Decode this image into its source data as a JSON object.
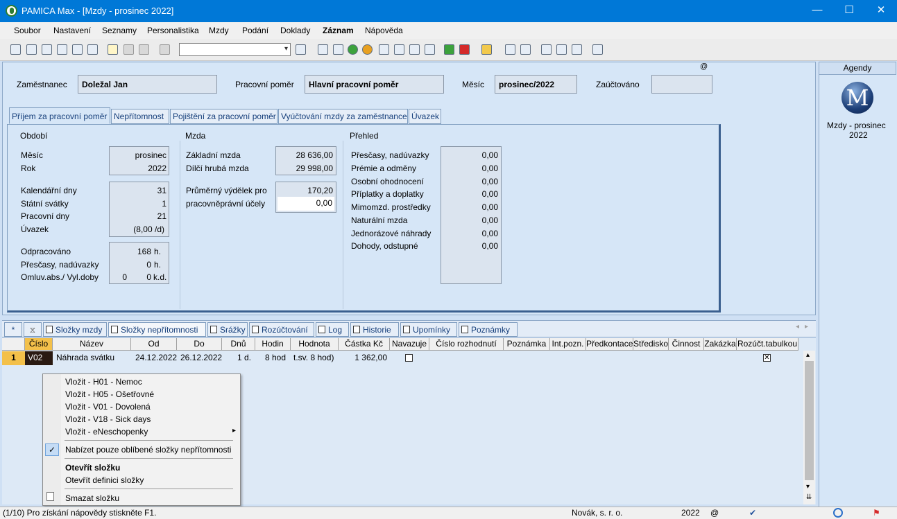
{
  "window": {
    "title": "PAMICA Max - [Mzdy - prosinec 2022]",
    "minimize": "—",
    "maximize": "☐",
    "close": "✕"
  },
  "menu": [
    "Soubor",
    "Nastavení",
    "Seznamy",
    "Personalistika",
    "Mzdy",
    "Podání",
    "Doklady",
    "Záznam",
    "Nápověda"
  ],
  "header": {
    "employee_label": "Zaměstnanec",
    "employee_value": "Doležal Jan",
    "relation_label": "Pracovní poměr",
    "relation_value": "Hlavní pracovní poměr",
    "month_label": "Měsíc",
    "month_value": "prosinec/2022",
    "posted_label": "Zaúčtováno",
    "posted_value": "",
    "at_sign": "@"
  },
  "tabs": [
    "Příjem za pracovní poměr",
    "Nepřítomnost",
    "Pojištění za pracovní poměr",
    "Vyúčtování mzdy za zaměstnance",
    "Úvazek"
  ],
  "period": {
    "title": "Období",
    "month_label": "Měsíc",
    "month_value": "prosinec",
    "year_label": "Rok",
    "year_value": "2022",
    "cal_days_label": "Kalendářní dny",
    "cal_days": "31",
    "holidays_label": "Státní svátky",
    "holidays": "1",
    "work_days_label": "Pracovní dny",
    "work_days": "21",
    "load_label": "Úvazek",
    "load": "(8,00 /d)",
    "worked_label": "Odpracováno",
    "worked": "168",
    "worked_unit": "h.",
    "overtime_label": "Přesčasy, nadúvazky",
    "overtime": "0",
    "overtime_unit": "h.",
    "absence_label": "Omluv.abs./ Vyl.doby",
    "absence_a": "0",
    "absence_b": "0",
    "absence_unit": "k.d."
  },
  "wage": {
    "title": "Mzda",
    "base_label": "Základní mzda",
    "base": "28 636,00",
    "gross_label": "Dílčí hrubá mzda",
    "gross": "29 998,00",
    "avg_label_1": "Průměrný výdělek pro",
    "avg_label_2": "pracovněprávní účely",
    "avg_1": "170,20",
    "avg_2": "0,00"
  },
  "overview": {
    "title": "Přehled",
    "rows": [
      {
        "label": "Přesčasy, nadúvazky",
        "value": "0,00"
      },
      {
        "label": "Prémie a odměny",
        "value": "0,00"
      },
      {
        "label": "Osobní ohodnocení",
        "value": "0,00"
      },
      {
        "label": "Příplatky a doplatky",
        "value": "0,00"
      },
      {
        "label": "Mimomzd. prostředky",
        "value": "0,00"
      },
      {
        "label": "Naturální mzda",
        "value": "0,00"
      },
      {
        "label": "Jednorázové náhrady",
        "value": "0,00"
      },
      {
        "label": "Dohody, odstupné",
        "value": "0,00"
      }
    ]
  },
  "agenda": {
    "header": "Agendy",
    "logo_letter": "M",
    "item_line1": "Mzdy - prosinec",
    "item_line2": "2022"
  },
  "subtabs": [
    "Složky mzdy",
    "Složky nepřítomnosti",
    "Srážky",
    "Rozúčtování",
    "Log",
    "Historie",
    "Upomínky",
    "Poznámky"
  ],
  "subtab_star": "*",
  "grid": {
    "columns": [
      "Číslo",
      "Název",
      "Od",
      "Do",
      "Dnů",
      "Hodin",
      "Hodnota",
      "Částka Kč",
      "Navazuje",
      "Číslo rozhodnutí",
      "Poznámka",
      "Int.pozn.",
      "Předkontace",
      "Středisko",
      "Činnost",
      "Zakázka",
      "Rozúčt.tabulkou"
    ],
    "row": {
      "index": "1",
      "code": "V02",
      "name": "Náhrada svátku",
      "from": "24.12.2022",
      "to": "26.12.2022",
      "days": "1 d.",
      "hours": "8 hod",
      "value": "t.sv. 8 hod)",
      "amount": "1 362,00",
      "alloc_mark": "✕"
    }
  },
  "context_menu": {
    "items": [
      "Vložit - H01 - Nemoc",
      "Vložit - H05 - Ošetřovné",
      "Vložit - V01 - Dovolená",
      "Vložit - V18 - Sick days",
      "Vložit - eNeschopenky"
    ],
    "favorite": "Nabízet pouze oblíbené složky nepřítomnosti",
    "open": "Otevřít složku",
    "open_def": "Otevřít definici složky",
    "delete": "Smazat složku",
    "check": "✓",
    "submenu_arrow": "▸"
  },
  "status": {
    "hint": "(1/10) Pro získání nápovědy stiskněte F1.",
    "company": "Novák, s. r. o.",
    "year": "2022",
    "at": "@"
  },
  "colors": {
    "titlebar": "#0078d7",
    "panel": "#d6e6f7",
    "tab_text": "#153e7a"
  }
}
